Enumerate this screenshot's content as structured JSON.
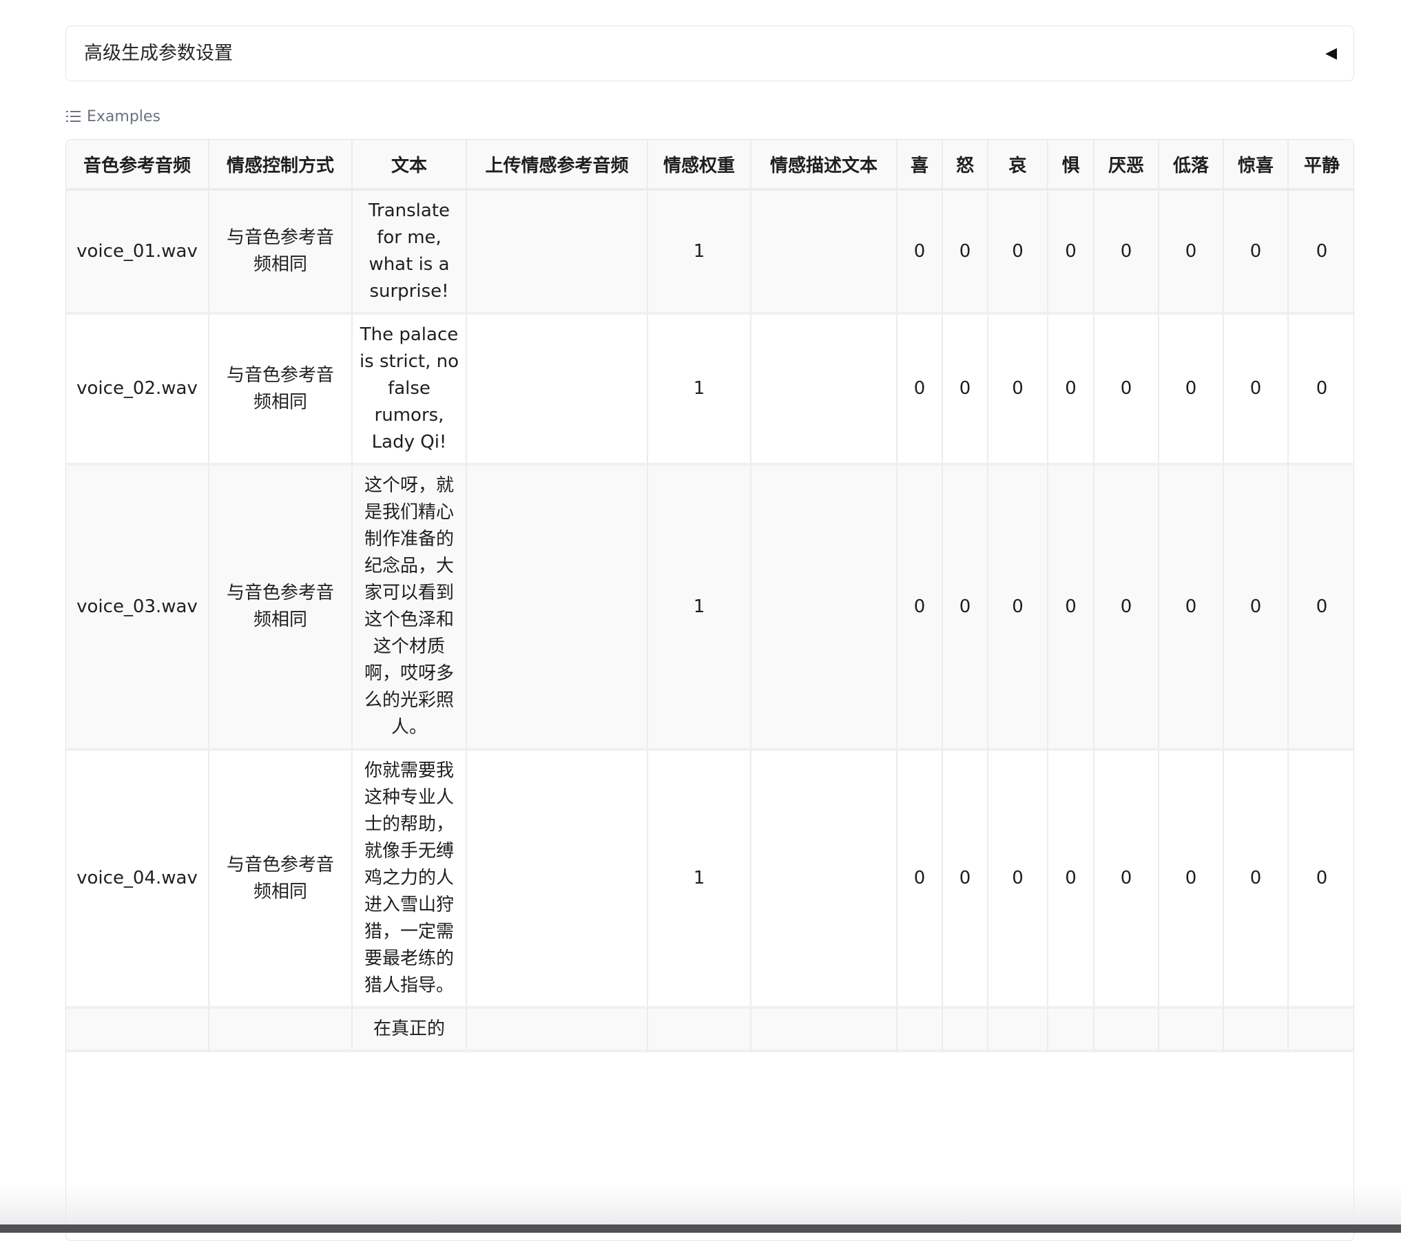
{
  "accordion": {
    "title": "高级生成参数设置",
    "toggle_glyph": "◀"
  },
  "examples": {
    "label": "Examples"
  },
  "table": {
    "headers": [
      "音色参考音频",
      "情感控制方式",
      "文本",
      "上传情感参考音频",
      "情感权重",
      "情感描述文本",
      "喜",
      "怒",
      "哀",
      "惧",
      "厌恶",
      "低落",
      "惊喜",
      "平静"
    ],
    "rows": [
      {
        "audio": "voice_01.wav",
        "mode": "与音色参考音频相同",
        "text": "Translate for me, what is a surprise!",
        "emo_audio": "",
        "weight": "1",
        "emo_text": "",
        "vals": [
          "0",
          "0",
          "0",
          "0",
          "0",
          "0",
          "0",
          "0"
        ]
      },
      {
        "audio": "voice_02.wav",
        "mode": "与音色参考音频相同",
        "text": "The palace is strict, no false rumors, Lady Qi!",
        "emo_audio": "",
        "weight": "1",
        "emo_text": "",
        "vals": [
          "0",
          "0",
          "0",
          "0",
          "0",
          "0",
          "0",
          "0"
        ]
      },
      {
        "audio": "voice_03.wav",
        "mode": "与音色参考音频相同",
        "text": "这个呀，就是我们精心制作准备的纪念品，大家可以看到这个色泽和这个材质啊，哎呀多么的光彩照人。",
        "emo_audio": "",
        "weight": "1",
        "emo_text": "",
        "vals": [
          "0",
          "0",
          "0",
          "0",
          "0",
          "0",
          "0",
          "0"
        ]
      },
      {
        "audio": "voice_04.wav",
        "mode": "与音色参考音频相同",
        "text": "你就需要我这种专业人士的帮助，就像手无缚鸡之力的人进入雪山狩猎，一定需要最老练的猎人指导。",
        "emo_audio": "",
        "weight": "1",
        "emo_text": "",
        "vals": [
          "0",
          "0",
          "0",
          "0",
          "0",
          "0",
          "0",
          "0"
        ]
      },
      {
        "audio": "",
        "mode": "",
        "text": "在真正的",
        "emo_audio": "",
        "weight": "",
        "emo_text": "",
        "vals": [
          "",
          "",
          "",
          "",
          "",
          "",
          "",
          ""
        ]
      }
    ]
  }
}
